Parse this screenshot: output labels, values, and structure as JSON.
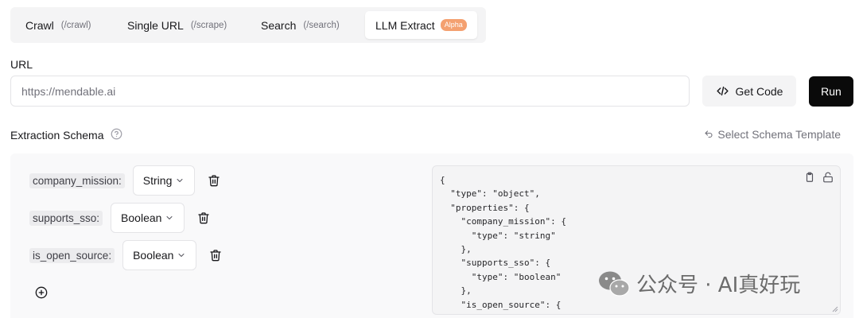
{
  "tabs": [
    {
      "label": "Crawl",
      "path": "(/crawl)"
    },
    {
      "label": "Single URL",
      "path": "(/scrape)"
    },
    {
      "label": "Search",
      "path": "(/search)"
    },
    {
      "label": "LLM Extract",
      "badge": "Alpha",
      "active": true
    }
  ],
  "url": {
    "label": "URL",
    "placeholder": "https://mendable.ai",
    "value": ""
  },
  "buttons": {
    "get_code": "Get Code",
    "run": "Run"
  },
  "schema": {
    "label": "Extraction Schema",
    "template_link": "Select Schema Template",
    "fields": [
      {
        "name": "company_mission:",
        "type": "String"
      },
      {
        "name": "supports_sso:",
        "type": "Boolean"
      },
      {
        "name": "is_open_source:",
        "type": "Boolean"
      }
    ],
    "json_text": "{\n  \"type\": \"object\",\n  \"properties\": {\n    \"company_mission\": {\n      \"type\": \"string\"\n    },\n    \"supports_sso\": {\n      \"type\": \"boolean\"\n    },\n    \"is_open_source\": {"
  },
  "watermark": "公众号 · AI真好玩",
  "colors": {
    "accent_badge": "#f4a070",
    "run_button": "#0a0a0a",
    "muted": "#71717a"
  }
}
